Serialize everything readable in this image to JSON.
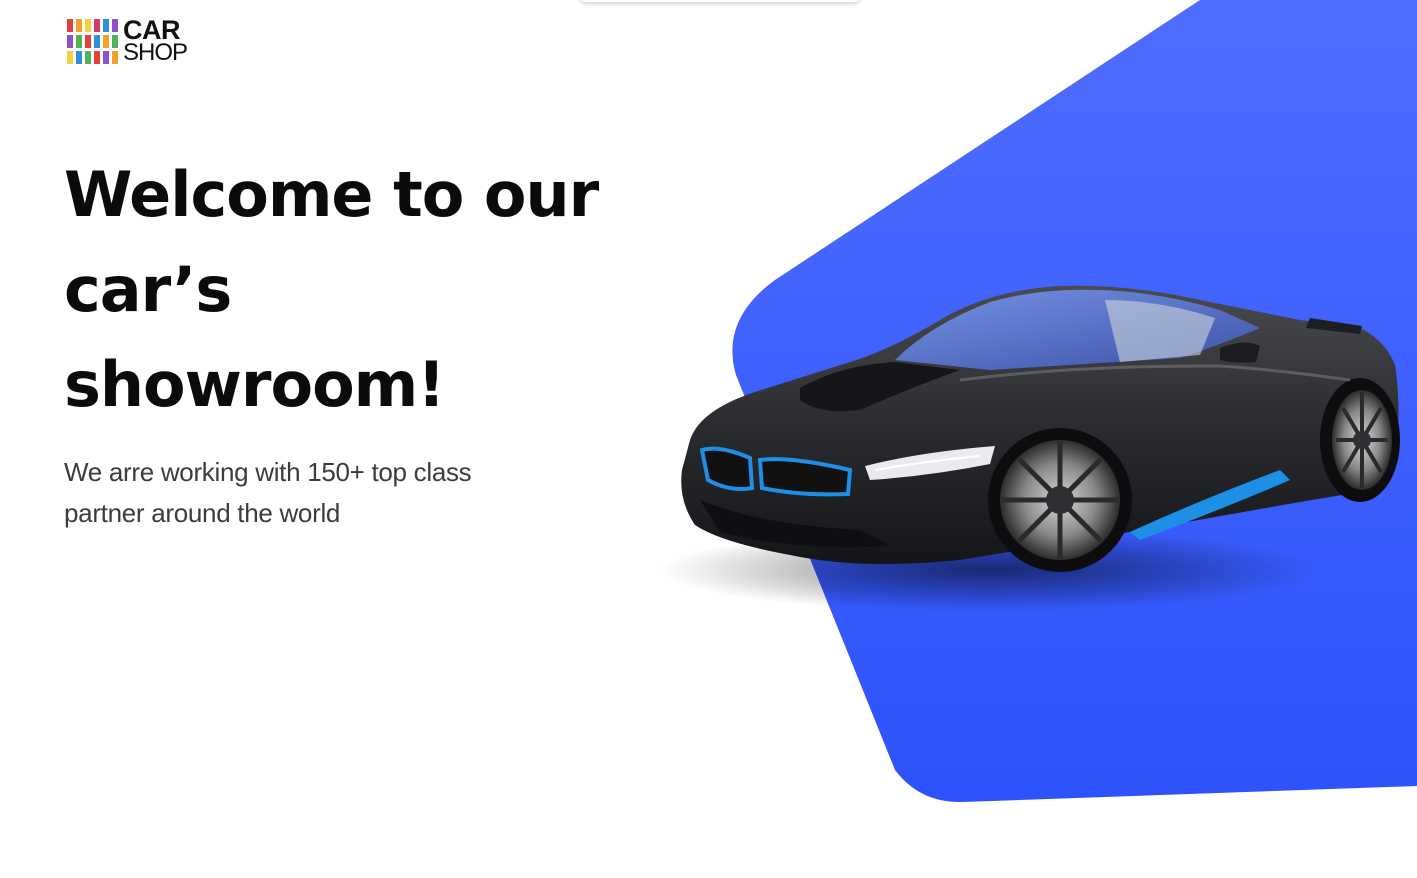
{
  "brand": {
    "line1": "CAR",
    "line2": "SHOP",
    "stripe_colors": [
      "#e6403c",
      "#f2a22b",
      "#f4d23d",
      "#4fb35a",
      "#2f8fd8",
      "#8e4fc8"
    ]
  },
  "hero": {
    "headline_lines": [
      "Welcome to our",
      "car’s",
      "showroom!"
    ],
    "subtitle": "We arre working with 150+ top class partner around the world"
  },
  "colors": {
    "accent_blue": "#3a5cfb",
    "text_dark": "#0b0b0b"
  }
}
